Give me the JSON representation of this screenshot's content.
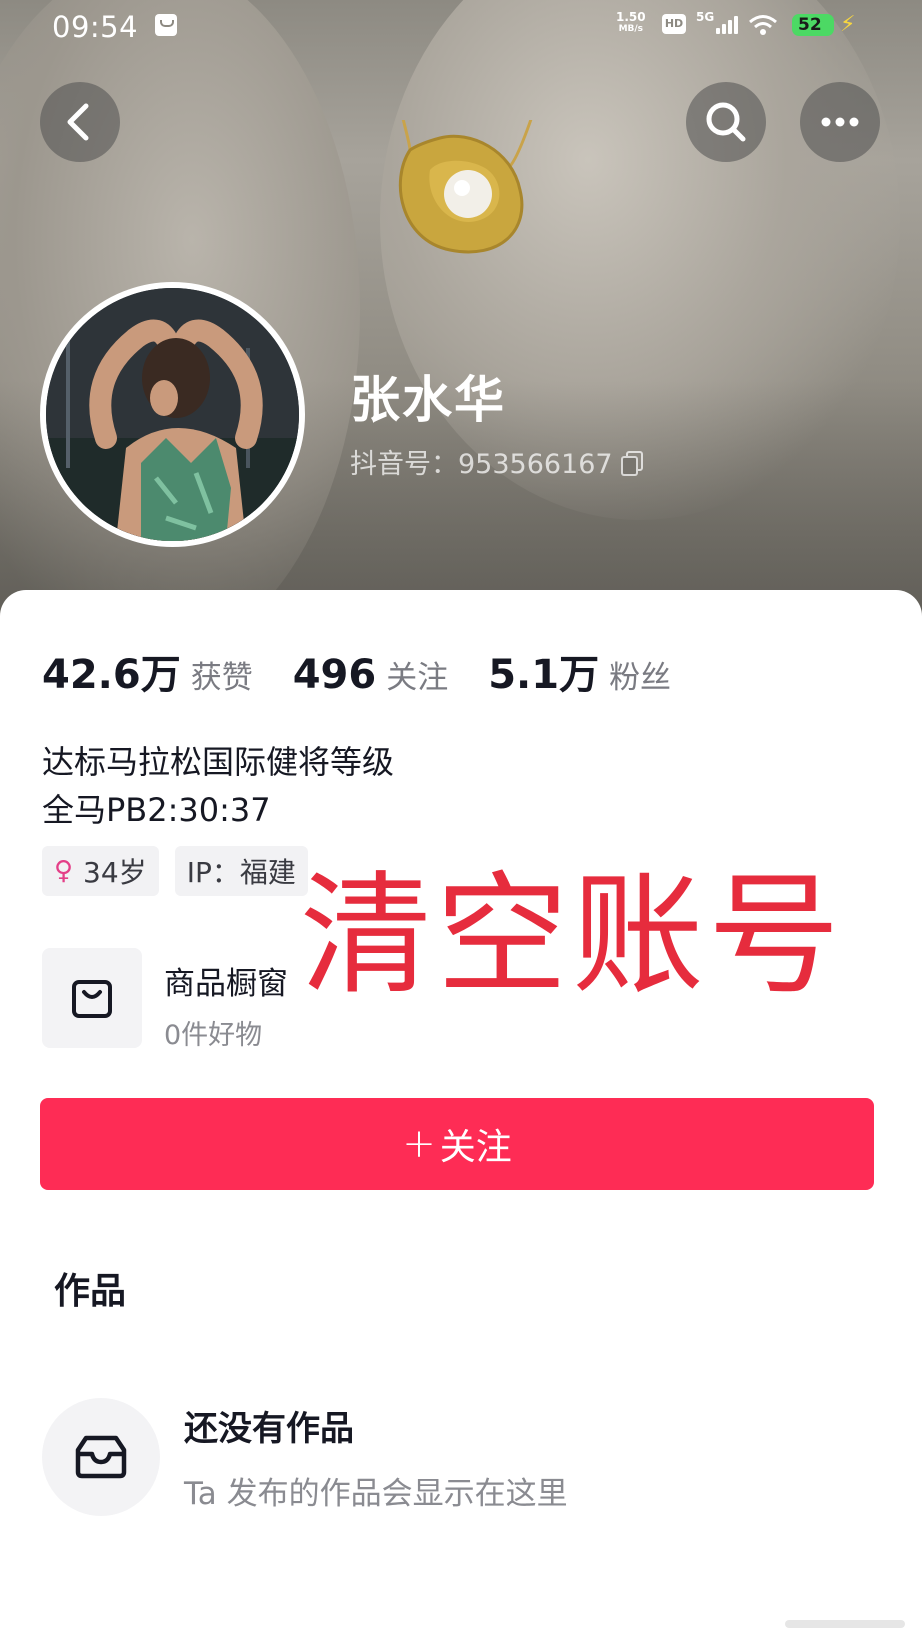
{
  "status_bar": {
    "time": "09:54",
    "speed_value": "1.50",
    "speed_unit": "MB/s",
    "hd": "HD",
    "network": "5G",
    "battery": "52"
  },
  "header": {
    "back_icon": "chevron-left-icon",
    "search_icon": "search-icon",
    "more_icon": "more-dots-icon"
  },
  "profile": {
    "nickname": "张水华",
    "douyin_id": "抖音号：953566167"
  },
  "stats": [
    {
      "value": "42.6万",
      "label": "获赞"
    },
    {
      "value": "496",
      "label": "关注"
    },
    {
      "value": "5.1万",
      "label": "粉丝"
    }
  ],
  "bio": {
    "line1": "达标马拉松国际健将等级",
    "line2": "全马PB2:30:37"
  },
  "tags": {
    "age": "34岁",
    "ip": "IP：福建"
  },
  "shop": {
    "title": "商品橱窗",
    "subtitle": "0件好物"
  },
  "overlay": "清空账号",
  "follow_button": {
    "plus": "+",
    "label": "关注"
  },
  "works": {
    "tab_title": "作品",
    "empty_title": "还没有作品",
    "empty_subtitle": "Ta 发布的作品会显示在这里"
  },
  "colors": {
    "accent": "#fe2c55",
    "overlay_red": "#e62c3d",
    "female": "#e43f88"
  }
}
